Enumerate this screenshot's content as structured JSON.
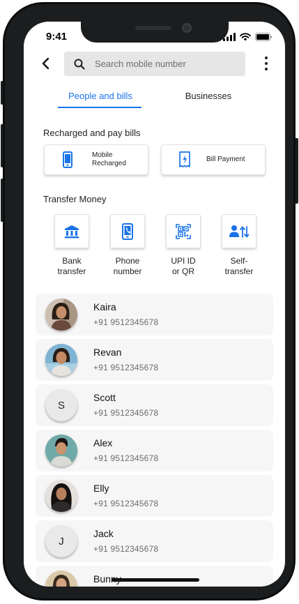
{
  "status": {
    "time": "9:41"
  },
  "search": {
    "placeholder": "Search mobile number"
  },
  "tabs": [
    {
      "label": "People and bills",
      "active": true
    },
    {
      "label": "Businesses",
      "active": false
    }
  ],
  "bills": {
    "title": "Recharged and pay bills",
    "items": [
      {
        "label": "Mobile\nRecharged",
        "icon": "smartphone-icon"
      },
      {
        "label": "Bill Payment",
        "icon": "bill-receipt-icon"
      }
    ]
  },
  "transfer": {
    "title": "Transfer Money",
    "items": [
      {
        "label": "Bank\ntransfer",
        "icon": "bank-icon"
      },
      {
        "label": "Phone\nnumber",
        "icon": "phone-number-icon"
      },
      {
        "label": "UPI ID\nor QR",
        "icon": "qr-code-icon"
      },
      {
        "label": "Self-\ntransfer",
        "icon": "self-transfer-icon"
      }
    ]
  },
  "contacts": [
    {
      "name": "Kaira",
      "phone": "+91 9512345678",
      "avatar": "photo"
    },
    {
      "name": "Revan",
      "phone": "+91 9512345678",
      "avatar": "photo"
    },
    {
      "name": "Scott",
      "phone": "+91 9512345678",
      "avatar": "initial",
      "initial": "S"
    },
    {
      "name": "Alex",
      "phone": "+91 9512345678",
      "avatar": "photo"
    },
    {
      "name": "Elly",
      "phone": "+91 9512345678",
      "avatar": "photo"
    },
    {
      "name": "Jack",
      "phone": "+91 9512345678",
      "avatar": "initial",
      "initial": "J"
    },
    {
      "name": "Bunny",
      "phone": "",
      "avatar": "photo"
    }
  ],
  "colors": {
    "accent": "#1a73e8",
    "card_bg": "#f6f6f6"
  }
}
